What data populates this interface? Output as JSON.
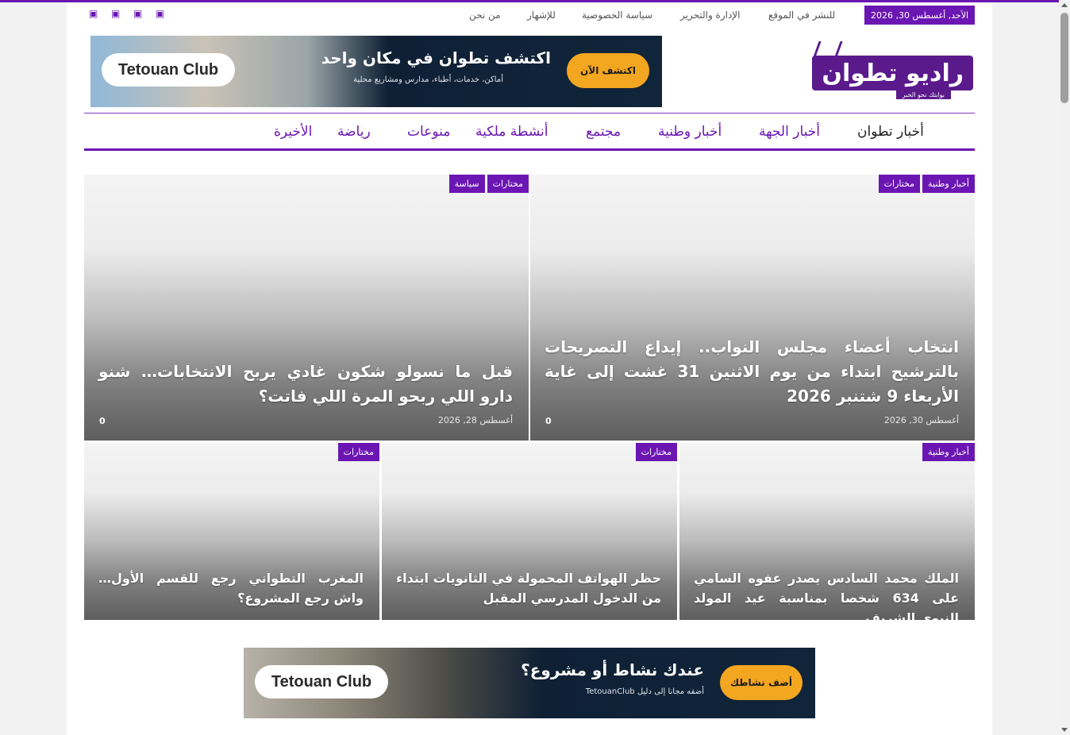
{
  "topbar": {
    "date": "الأحد, أغسطس 30, 2026",
    "links": [
      "للنشر في الموقع",
      "الإدارة والتحرير",
      "سياسة الخصوصية",
      "للإشهار",
      "من نحن"
    ],
    "social_icons": [
      "social-icon-1",
      "social-icon-2",
      "social-icon-3",
      "social-icon-4"
    ]
  },
  "logo": {
    "name": "راديو تطوان",
    "tagline": "بوابتك نحو الخبر"
  },
  "banner_top": {
    "brand": "Tetouan Club",
    "headline": "اكتشف تطوان في مكان واحد",
    "subline": "أماكن، خدمات، أطباء، مدارس ومشاريع محلية",
    "button": "اكتشف الآن"
  },
  "nav": {
    "items": [
      "أخبار تطوان",
      "أخبار الجهة",
      "أخبار وطنية",
      "مجتمع",
      "أنشطة ملكية",
      "منوعات",
      "رياضة",
      "الأخيرة"
    ]
  },
  "featured": [
    {
      "categories": [
        "أخبار وطنية",
        "مختارات"
      ],
      "title": "انتخاب أعضاء مجلس النواب.. إيداع التصريحات بالترشيح ابتداء من يوم الاثنين 31 غشت إلى غاية الأربعاء 9 شتنبر 2026",
      "date": "أغسطس 30, 2026",
      "comments": "0"
    },
    {
      "categories": [
        "مختارات",
        "سياسة"
      ],
      "title": "قبل ما نسولو شكون غادي يربح الانتخابات… شنو دارو اللي ربحو المرة اللي فاتت؟",
      "date": "أغسطس 28, 2026",
      "comments": "0"
    }
  ],
  "secondary": [
    {
      "categories": [
        "أخبار وطنية"
      ],
      "title": "الملك محمد السادس يصدر عفوه السامي على 634 شخصا بمناسبة عيد المولد النبوي الشريف"
    },
    {
      "categories": [
        "مختارات"
      ],
      "title": "حظر الهواتف المحمولة في الثانويات ابتداء من الدخول المدرسي المقبل"
    },
    {
      "categories": [
        "مختارات"
      ],
      "title": "المغرب التطواني رجع للقسم الأول… واش رجع المشروع؟"
    }
  ],
  "banner_bottom": {
    "brand": "Tetouan Club",
    "headline": "عندك نشاط أو مشروع؟",
    "subline": "أضفه مجانا إلى دليل TetouanClub",
    "button": "أضف نشاطك"
  },
  "colors": {
    "accent": "#6b16b3",
    "button": "#f3a620"
  }
}
